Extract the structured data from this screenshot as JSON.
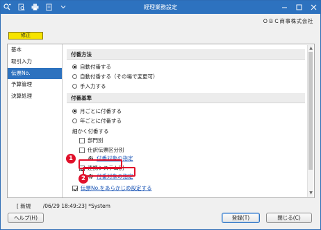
{
  "window": {
    "title": "経理業務設定"
  },
  "company": "ＯＢＣ商事株式会社",
  "mode_badge": "修正",
  "sidebar": {
    "items": [
      {
        "label": "基本",
        "active": false
      },
      {
        "label": "取引入力",
        "active": false
      },
      {
        "label": "伝票No.",
        "active": true
      },
      {
        "label": "予算管理",
        "active": false
      },
      {
        "label": "決算処理",
        "active": false
      }
    ]
  },
  "content": {
    "numbering_method": {
      "heading": "付番方法",
      "options": [
        {
          "label": "自動付番する",
          "selected": true
        },
        {
          "label": "自動付番する（その場で変更可）",
          "selected": false
        },
        {
          "label": "手入力する",
          "selected": false
        }
      ]
    },
    "numbering_basis": {
      "heading": "付番基準",
      "options": [
        {
          "label": "月ごとに付番する",
          "selected": true
        },
        {
          "label": "年ごとに付番する",
          "selected": false
        }
      ],
      "detail_label": "細かく付番する",
      "detail_options": [
        {
          "label": "部門別",
          "checked": false
        },
        {
          "label": "仕訳伝票区分別",
          "checked": false
        },
        {
          "label": "連携システム別",
          "checked": true
        }
      ],
      "target_link_1": "付番対象の指定",
      "target_link_2": "付番対象の指定",
      "preset_label": "伝票No.をあらかじめ設定する",
      "preset_checked": true
    },
    "callouts": [
      "1",
      "2"
    ]
  },
  "status": {
    "text": "[ 新規 　　/06/29 18:49:23]  *System"
  },
  "buttons": {
    "help": "ヘルプ(H)",
    "register": "登録(T)",
    "close": "閉じる(C)"
  },
  "colors": {
    "titlebar": "#2d72bf",
    "active_sidebar": "#2d72bf",
    "mode_badge": "#f7e400",
    "callout": "#e0102a",
    "link": "#1a55b6"
  }
}
